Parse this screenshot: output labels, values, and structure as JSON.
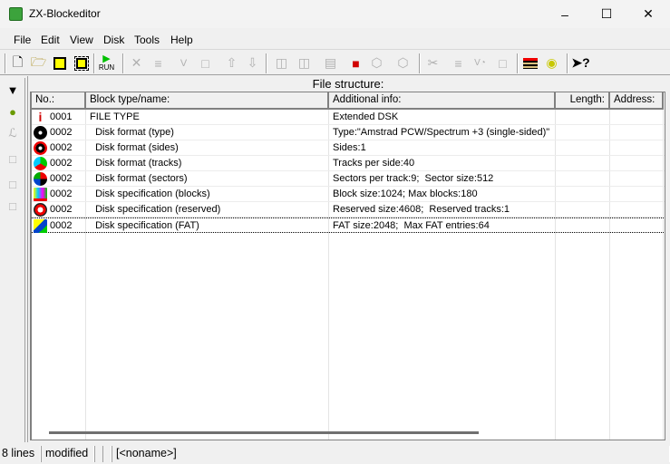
{
  "window": {
    "title": "ZX-Blockeditor"
  },
  "menu": [
    "File",
    "Edit",
    "View",
    "Disk",
    "Tools",
    "Help"
  ],
  "toolbar": [
    {
      "icon": "new-file-icon",
      "enabled": true
    },
    {
      "icon": "open-folder-icon",
      "enabled": true
    },
    {
      "icon": "save-icon",
      "enabled": true
    },
    {
      "icon": "save-all-icon",
      "enabled": true
    },
    {
      "icon": "run-icon",
      "label": "RUN",
      "enabled": true
    },
    {
      "icon": "delete-icon",
      "enabled": false
    },
    {
      "icon": "edit-icon",
      "enabled": false
    },
    {
      "icon": "rename-icon",
      "enabled": false
    },
    {
      "icon": "paste-icon",
      "enabled": false
    },
    {
      "icon": "move-up-icon",
      "enabled": false
    },
    {
      "icon": "move-down-icon",
      "enabled": false
    },
    {
      "icon": "split-icon",
      "enabled": false
    },
    {
      "icon": "merge-icon",
      "enabled": false
    },
    {
      "icon": "window-icon",
      "enabled": false
    },
    {
      "icon": "add-block-icon",
      "enabled": true
    },
    {
      "icon": "block-export-icon",
      "enabled": false
    },
    {
      "icon": "block-icon",
      "enabled": false
    },
    {
      "icon": "cut-icon",
      "enabled": false
    },
    {
      "icon": "copy-icon",
      "enabled": false
    },
    {
      "icon": "version-icon",
      "enabled": false
    },
    {
      "icon": "clipboard-icon",
      "enabled": false
    },
    {
      "icon": "tape-icon",
      "enabled": true
    },
    {
      "icon": "cassette-icon",
      "enabled": true
    },
    {
      "icon": "context-help-icon",
      "enabled": true
    }
  ],
  "main": {
    "heading": "File structure:",
    "columns": [
      "No.:",
      "Block type/name:",
      "Additional info:",
      "Length:",
      "Address:"
    ],
    "rows": [
      {
        "icon": "info-icon",
        "no": "0001",
        "name": "FILE TYPE",
        "info": "Extended DSK",
        "length": "",
        "address": ""
      },
      {
        "icon": "disk-type-icon",
        "no": "0002",
        "name": "  Disk format (type)",
        "info": "Type:\"Amstrad PCW/Spectrum +3 (single-sided)\"",
        "length": "",
        "address": ""
      },
      {
        "icon": "disk-sides-icon",
        "no": "0002",
        "name": "  Disk format (sides)",
        "info": "Sides:1",
        "length": "",
        "address": ""
      },
      {
        "icon": "disk-tracks-icon",
        "no": "0002",
        "name": "  Disk format (tracks)",
        "info": "Tracks per side:40",
        "length": "",
        "address": ""
      },
      {
        "icon": "disk-sectors-icon",
        "no": "0002",
        "name": "  Disk format (sectors)",
        "info": "Sectors per track:9;  Sector size:512",
        "length": "",
        "address": ""
      },
      {
        "icon": "blocks-icon",
        "no": "0002",
        "name": "  Disk specification (blocks)",
        "info": "Block size:1024; Max blocks:180",
        "length": "",
        "address": ""
      },
      {
        "icon": "reserved-icon",
        "no": "0002",
        "name": "  Disk specification (reserved)",
        "info": "Reserved size:4608;  Reserved tracks:1",
        "length": "",
        "address": ""
      },
      {
        "icon": "fat-icon",
        "no": "0002",
        "name": "  Disk specification (FAT)",
        "info": "FAT size:2048;  Max FAT entries:64",
        "length": "",
        "address": ""
      }
    ],
    "selected_row": 7
  },
  "status": {
    "lines": "8 lines",
    "state": "modified",
    "p3": "",
    "p4": "",
    "file": "[<noname>]"
  }
}
